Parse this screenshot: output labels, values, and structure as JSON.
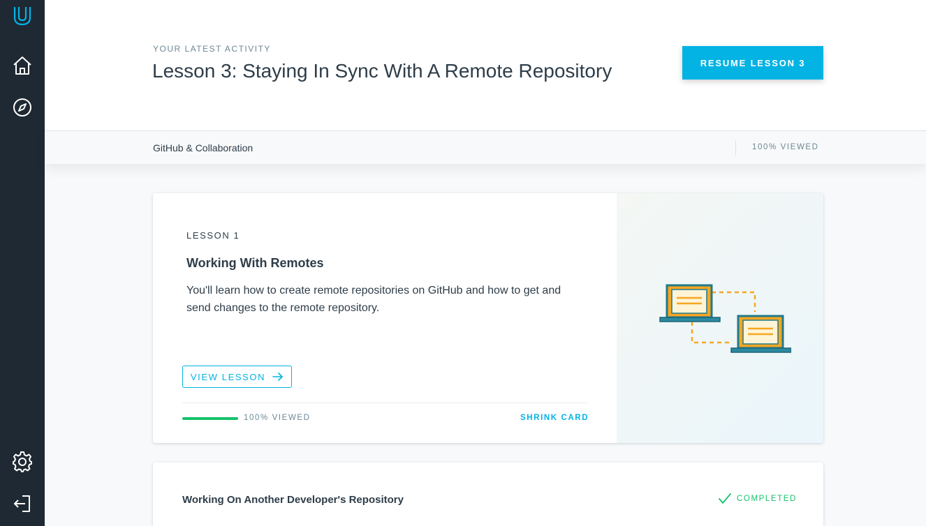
{
  "sidebar": {
    "items": [
      {
        "name": "logo",
        "icon": "udacity-logo-icon"
      },
      {
        "name": "home",
        "icon": "home-icon"
      },
      {
        "name": "catalog",
        "icon": "compass-icon"
      },
      {
        "name": "settings",
        "icon": "gear-icon"
      },
      {
        "name": "logout",
        "icon": "logout-icon"
      }
    ]
  },
  "header": {
    "eyebrow": "YOUR LATEST ACTIVITY",
    "title": "Lesson 3: Staying In Sync With A Remote Repository",
    "resume_label": "RESUME LESSON 3"
  },
  "subbar": {
    "course_name": "GitHub & Collaboration",
    "viewed": "100% VIEWED"
  },
  "lesson_card": {
    "label": "LESSON 1",
    "title": "Working With Remotes",
    "description": "You'll learn how to create remote repositories on GitHub and how to get and send changes to the remote repository.",
    "view_label": "VIEW LESSON",
    "progress_percent": 100,
    "progress_text": "100% VIEWED",
    "shrink_label": "SHRINK CARD",
    "illustration": "laptops-sync-illustration"
  },
  "next_card": {
    "title": "Working On Another Developer's Repository",
    "status": "COMPLETED",
    "status_icon": "checkmark-icon"
  },
  "colors": {
    "accent": "#02b3e4",
    "sidebar": "#1e2933",
    "success": "#15c26b",
    "text": "#2e3d49",
    "muted": "#6c8796"
  }
}
